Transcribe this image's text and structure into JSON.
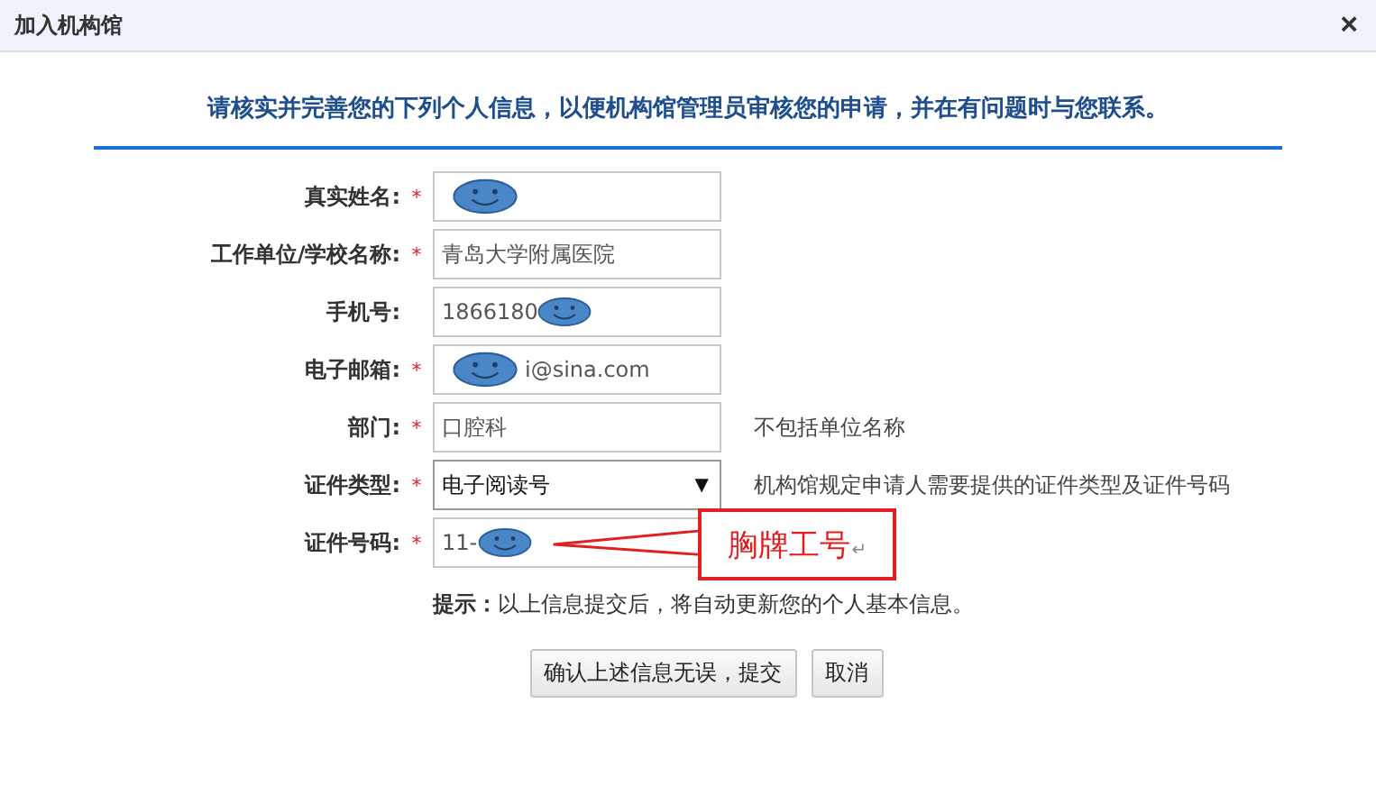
{
  "window": {
    "title": "加入机构馆",
    "close": "×"
  },
  "intro": "请核实并完善您的下列个人信息，以便机构馆管理员审核您的申请，并在有问题时与您联系。",
  "fields": [
    {
      "label": "真实姓名:",
      "required": true,
      "kind": "text",
      "masked_before": true,
      "masked_after": false
    },
    {
      "label": "工作单位/学校名称:",
      "required": true,
      "kind": "text",
      "value": "青岛大学附属医院",
      "masked_before": false,
      "masked_after": false
    },
    {
      "label": "手机号:",
      "required": false,
      "kind": "text",
      "value": "1866180",
      "masked_before": false,
      "masked_after": true
    },
    {
      "label": "电子邮箱:",
      "required": true,
      "kind": "text",
      "value": "i@sina.com",
      "masked_before": true,
      "masked_after": false
    },
    {
      "label": "部门:",
      "required": true,
      "kind": "text",
      "value": "口腔科",
      "hint": "不包括单位名称",
      "masked_before": false,
      "masked_after": false
    },
    {
      "label": "证件类型:",
      "required": true,
      "kind": "select",
      "value": "电子阅读号",
      "arrow": "▼",
      "hint": "机构馆规定申请人需要提供的证件类型及证件号码",
      "masked_before": false,
      "masked_after": false
    },
    {
      "label": "证件号码:",
      "required": true,
      "kind": "text",
      "value": "11-",
      "masked_before": false,
      "masked_after": true
    }
  ],
  "required_mark": "*",
  "tip": {
    "label": "提示：",
    "text": "以上信息提交后，将自动更新您的个人基本信息。"
  },
  "buttons": [
    "确认上述信息无误，提交",
    "取消"
  ],
  "callout": {
    "text": "胸牌工号",
    "mark": "↵"
  }
}
